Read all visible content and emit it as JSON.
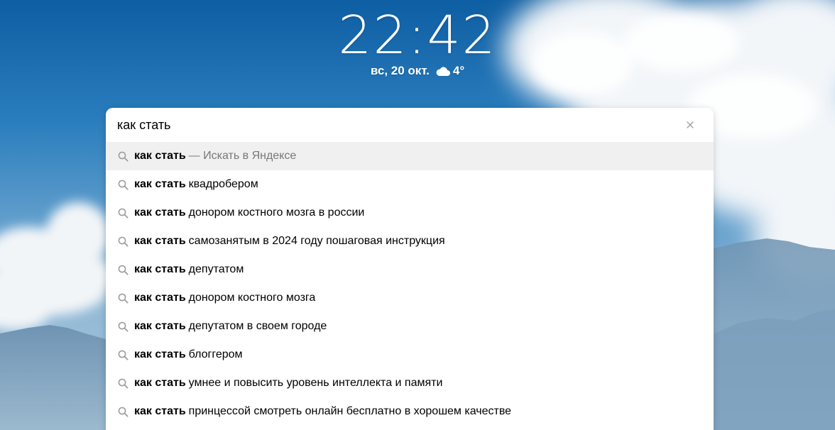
{
  "clock": {
    "time": "22:42"
  },
  "date": {
    "label": "вс, 20 окт."
  },
  "weather": {
    "temperature": "4°",
    "icon": "cloud-icon"
  },
  "search": {
    "value": "как стать",
    "clear_icon": "close-icon"
  },
  "suggestions": [
    {
      "query": "как стать",
      "rest": "",
      "hint": "— Искать в Яндексе",
      "active": true
    },
    {
      "query": "как стать",
      "rest": "квадробером",
      "hint": ""
    },
    {
      "query": "как стать",
      "rest": "донором костного мозга в россии",
      "hint": ""
    },
    {
      "query": "как стать",
      "rest": "самозанятым в 2024 году пошаговая инструкция",
      "hint": ""
    },
    {
      "query": "как стать",
      "rest": "депутатом",
      "hint": ""
    },
    {
      "query": "как стать",
      "rest": "донором костного мозга",
      "hint": ""
    },
    {
      "query": "как стать",
      "rest": "депутатом в своем городе",
      "hint": ""
    },
    {
      "query": "как стать",
      "rest": "блоггером",
      "hint": ""
    },
    {
      "query": "как стать",
      "rest": "умнее и повысить уровень интеллекта и памяти",
      "hint": ""
    },
    {
      "query": "как стать",
      "rest": "принцессой смотреть онлайн бесплатно в хорошем качестве",
      "hint": ""
    }
  ],
  "colors": {
    "highlight_row": "#f0f0f0",
    "hint_text": "#777777",
    "icon_gray": "#9e9e9e"
  }
}
